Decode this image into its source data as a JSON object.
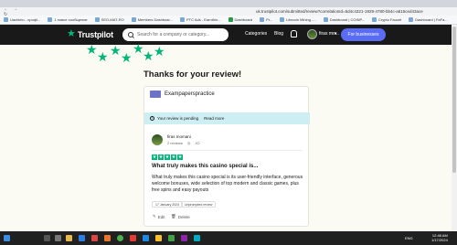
{
  "browser": {
    "url": "uk.trustpilot.com/submitted/review?correlationId=5d4c4321-1929-4780-bb4c-a615ced43ace",
    "bookmarks": [
      {
        "label": "Uachieio - npoфl..."
      },
      {
        "label": "1 новое сообщение"
      },
      {
        "label": "SEO-MAT-RO"
      },
      {
        "label": "Members Dashboar..."
      },
      {
        "label": "PTC Ads - Earnthin..."
      },
      {
        "label": "Dashboard"
      },
      {
        "label": "Pr..."
      },
      {
        "label": "Litecoin Mining -..."
      },
      {
        "label": "Dashboard | COINP..."
      },
      {
        "label": "Crypto Faucet"
      },
      {
        "label": "Dashboard | FaFa..."
      }
    ]
  },
  "header": {
    "logo_text": "Trustpilot",
    "search_placeholder": "Search for a company or category...",
    "nav": {
      "categories": "Categories",
      "blog": "Blog"
    },
    "user_name": "firas mo...",
    "business_button": "For businesses"
  },
  "page": {
    "title": "Thanks for your review!"
  },
  "review_card": {
    "company_name": "Exampaperspractice",
    "pending": {
      "text": "Your review is pending",
      "more": "Read more"
    },
    "reviewer": {
      "name": "firas momani",
      "reviews_count": "2 reviews",
      "country": "JO"
    },
    "rating": 5,
    "star_color": "#00b67a",
    "review_title": "What truly makes this casino special is...",
    "review_body": "What truly makes this casino special is its user-friendly interface, generous welcome bonuses, wide selection of top modern and classic games, plus free spins and easy payouts",
    "date_tag": "17 January 2024",
    "status_tag": "Unprompted review",
    "actions": {
      "edit": "Edit",
      "delete": "Delete"
    }
  },
  "taskbar": {
    "language": "ENG",
    "time": "12:48 AM",
    "date": "1/17/2024"
  },
  "colors": {
    "brand_green": "#00b67a",
    "header_bg": "#191919",
    "business_button": "#5a6cf3",
    "pending_bg": "#cdeef2"
  }
}
